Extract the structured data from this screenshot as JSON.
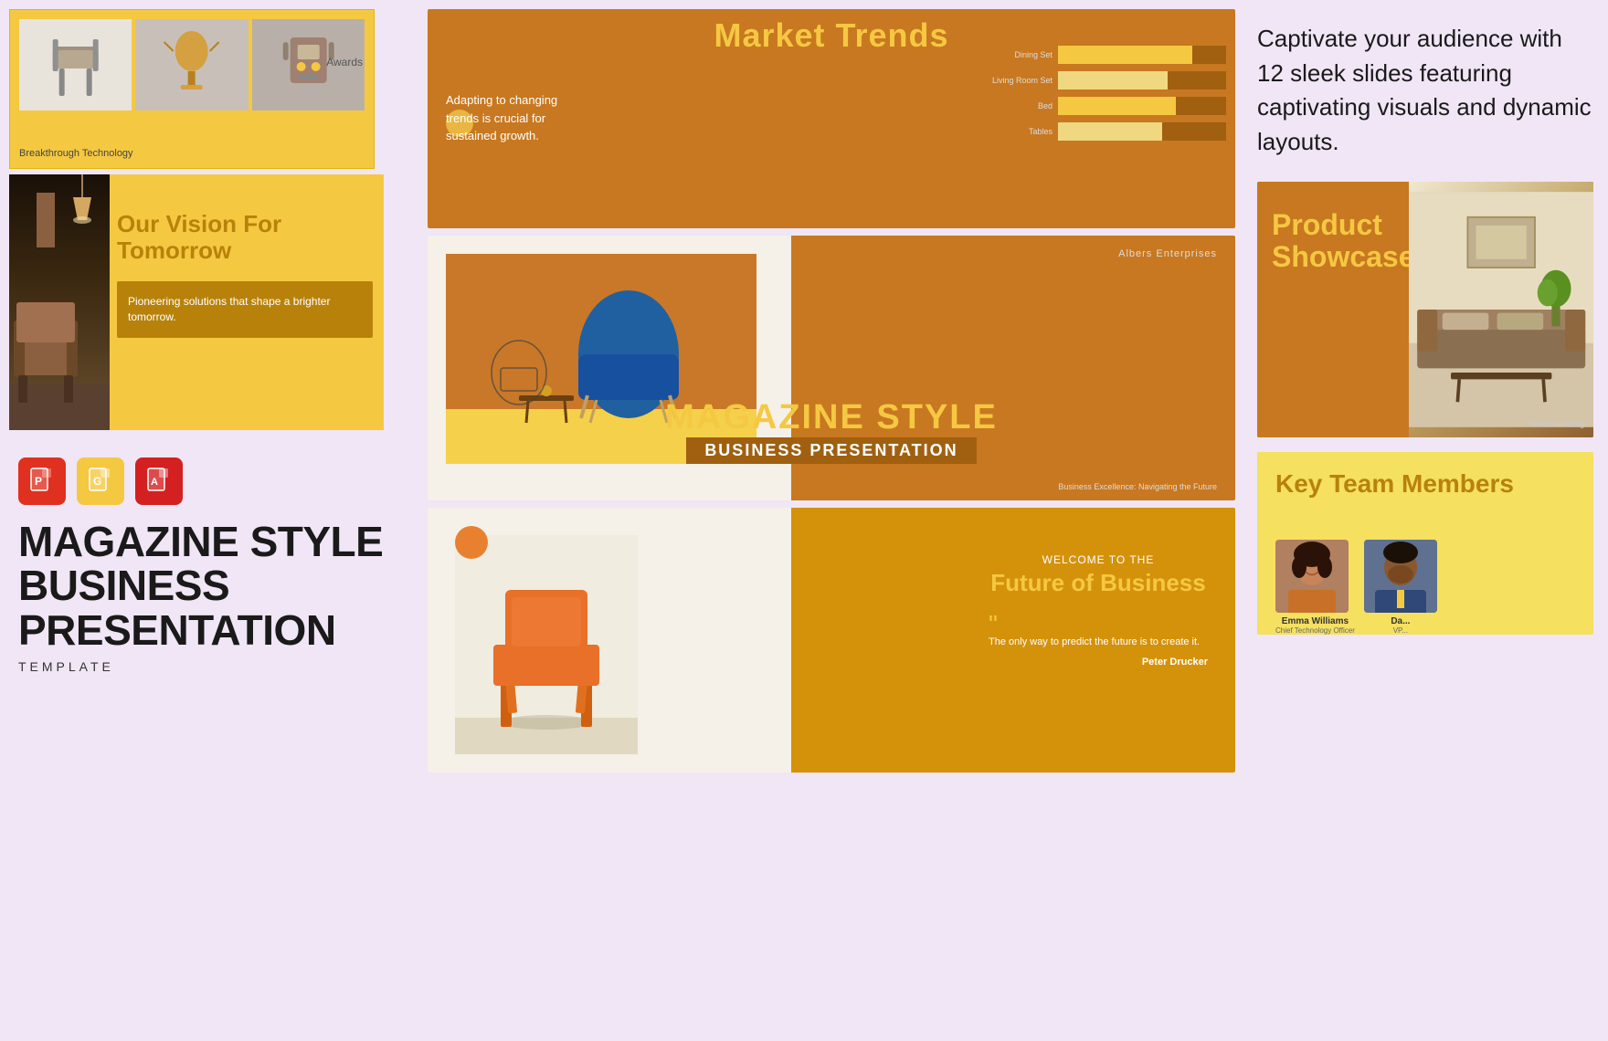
{
  "left": {
    "awards_label": "Awards",
    "breakthrough_label": "Breakthrough Technology",
    "vision_title": "Our Vision For Tomorrow",
    "vision_desc": "Pioneering solutions that shape a brighter tomorrow.",
    "format_icons": [
      {
        "label": "P",
        "type": "pptx",
        "color": "#e03020"
      },
      {
        "label": "G",
        "type": "gslides",
        "color": "#f5a020"
      },
      {
        "label": "A",
        "type": "pdf",
        "color": "#d42020"
      }
    ],
    "main_title_line1": "MAGAZINE STYLE",
    "main_title_line2": "BUSINESS",
    "main_title_line3": "PRESENTATION",
    "main_subtitle": "TEMPLATE"
  },
  "middle": {
    "market_trends_title": "Market Trends",
    "market_trends_desc": "Adapting to changing trends is crucial for sustained growth.",
    "chart_rows": [
      {
        "label": "Dining Set",
        "pct": 80,
        "type": "solid"
      },
      {
        "label": "Living Room Set",
        "pct": 65,
        "type": "light"
      },
      {
        "label": "Bed",
        "pct": 70,
        "type": "solid"
      },
      {
        "label": "Tables",
        "pct": 62,
        "type": "light"
      }
    ],
    "magazine_company": "Albers Enterprises",
    "magazine_style": "MAGAZINE STYLE",
    "magazine_biz": "BUSINESS PRESENTATION",
    "magazine_footer": "Business Excellence: Navigating the Future",
    "future_welcome": "WELCOME TO THE",
    "future_title": "Future of Business",
    "future_quote": "The only way to predict the future is to create it.",
    "future_attribution": "Peter Drucker"
  },
  "right": {
    "description": "Captivate your audience with 12 sleek slides featuring captivating visuals and dynamic layouts.",
    "product_title": "Product Showcase",
    "product_revolutionizing": "Revolutionizing",
    "team_title": "Key Team Members",
    "team_members": [
      {
        "name": "Emma Williams",
        "role": "Chief Technology Officer"
      },
      {
        "name": "Da...",
        "role": "VP..."
      }
    ]
  }
}
